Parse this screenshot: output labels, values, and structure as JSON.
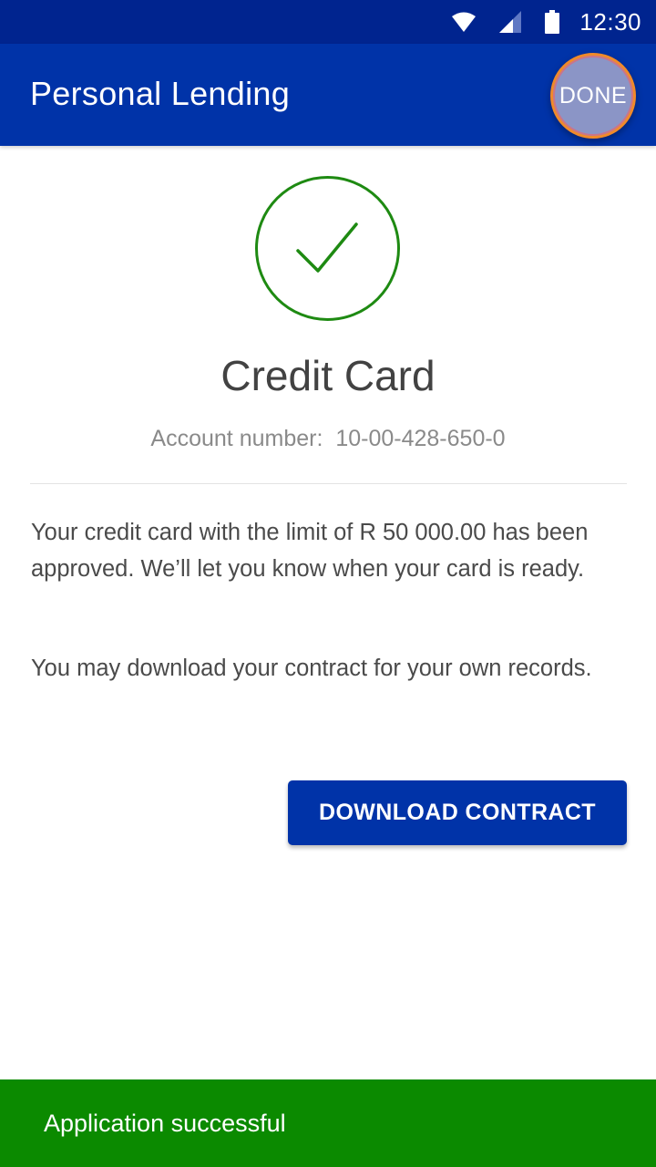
{
  "status_bar": {
    "time": "12:30",
    "icons": [
      "wifi-icon",
      "cellular-signal-icon",
      "battery-icon"
    ]
  },
  "app_bar": {
    "title": "Personal Lending",
    "done_label": "DONE"
  },
  "confirmation": {
    "icon": "check-circle-icon",
    "product_title": "Credit Card",
    "account_label": "Account number:",
    "account_number": "10-00-428-650-0",
    "message_1": "Your credit card with the limit of R 50 000.00 has been approved. We’ll let you know when your card is ready.",
    "message_2": "You may download your contract for your own records.",
    "download_label": "DOWNLOAD CONTRACT"
  },
  "snackbar": {
    "text": "Application successful"
  },
  "colors": {
    "status_bar": "#00248f",
    "app_bar": "#0033a8",
    "success_green": "#0b8a00",
    "check_green": "#1e8a12",
    "primary_button": "#0033a8"
  }
}
